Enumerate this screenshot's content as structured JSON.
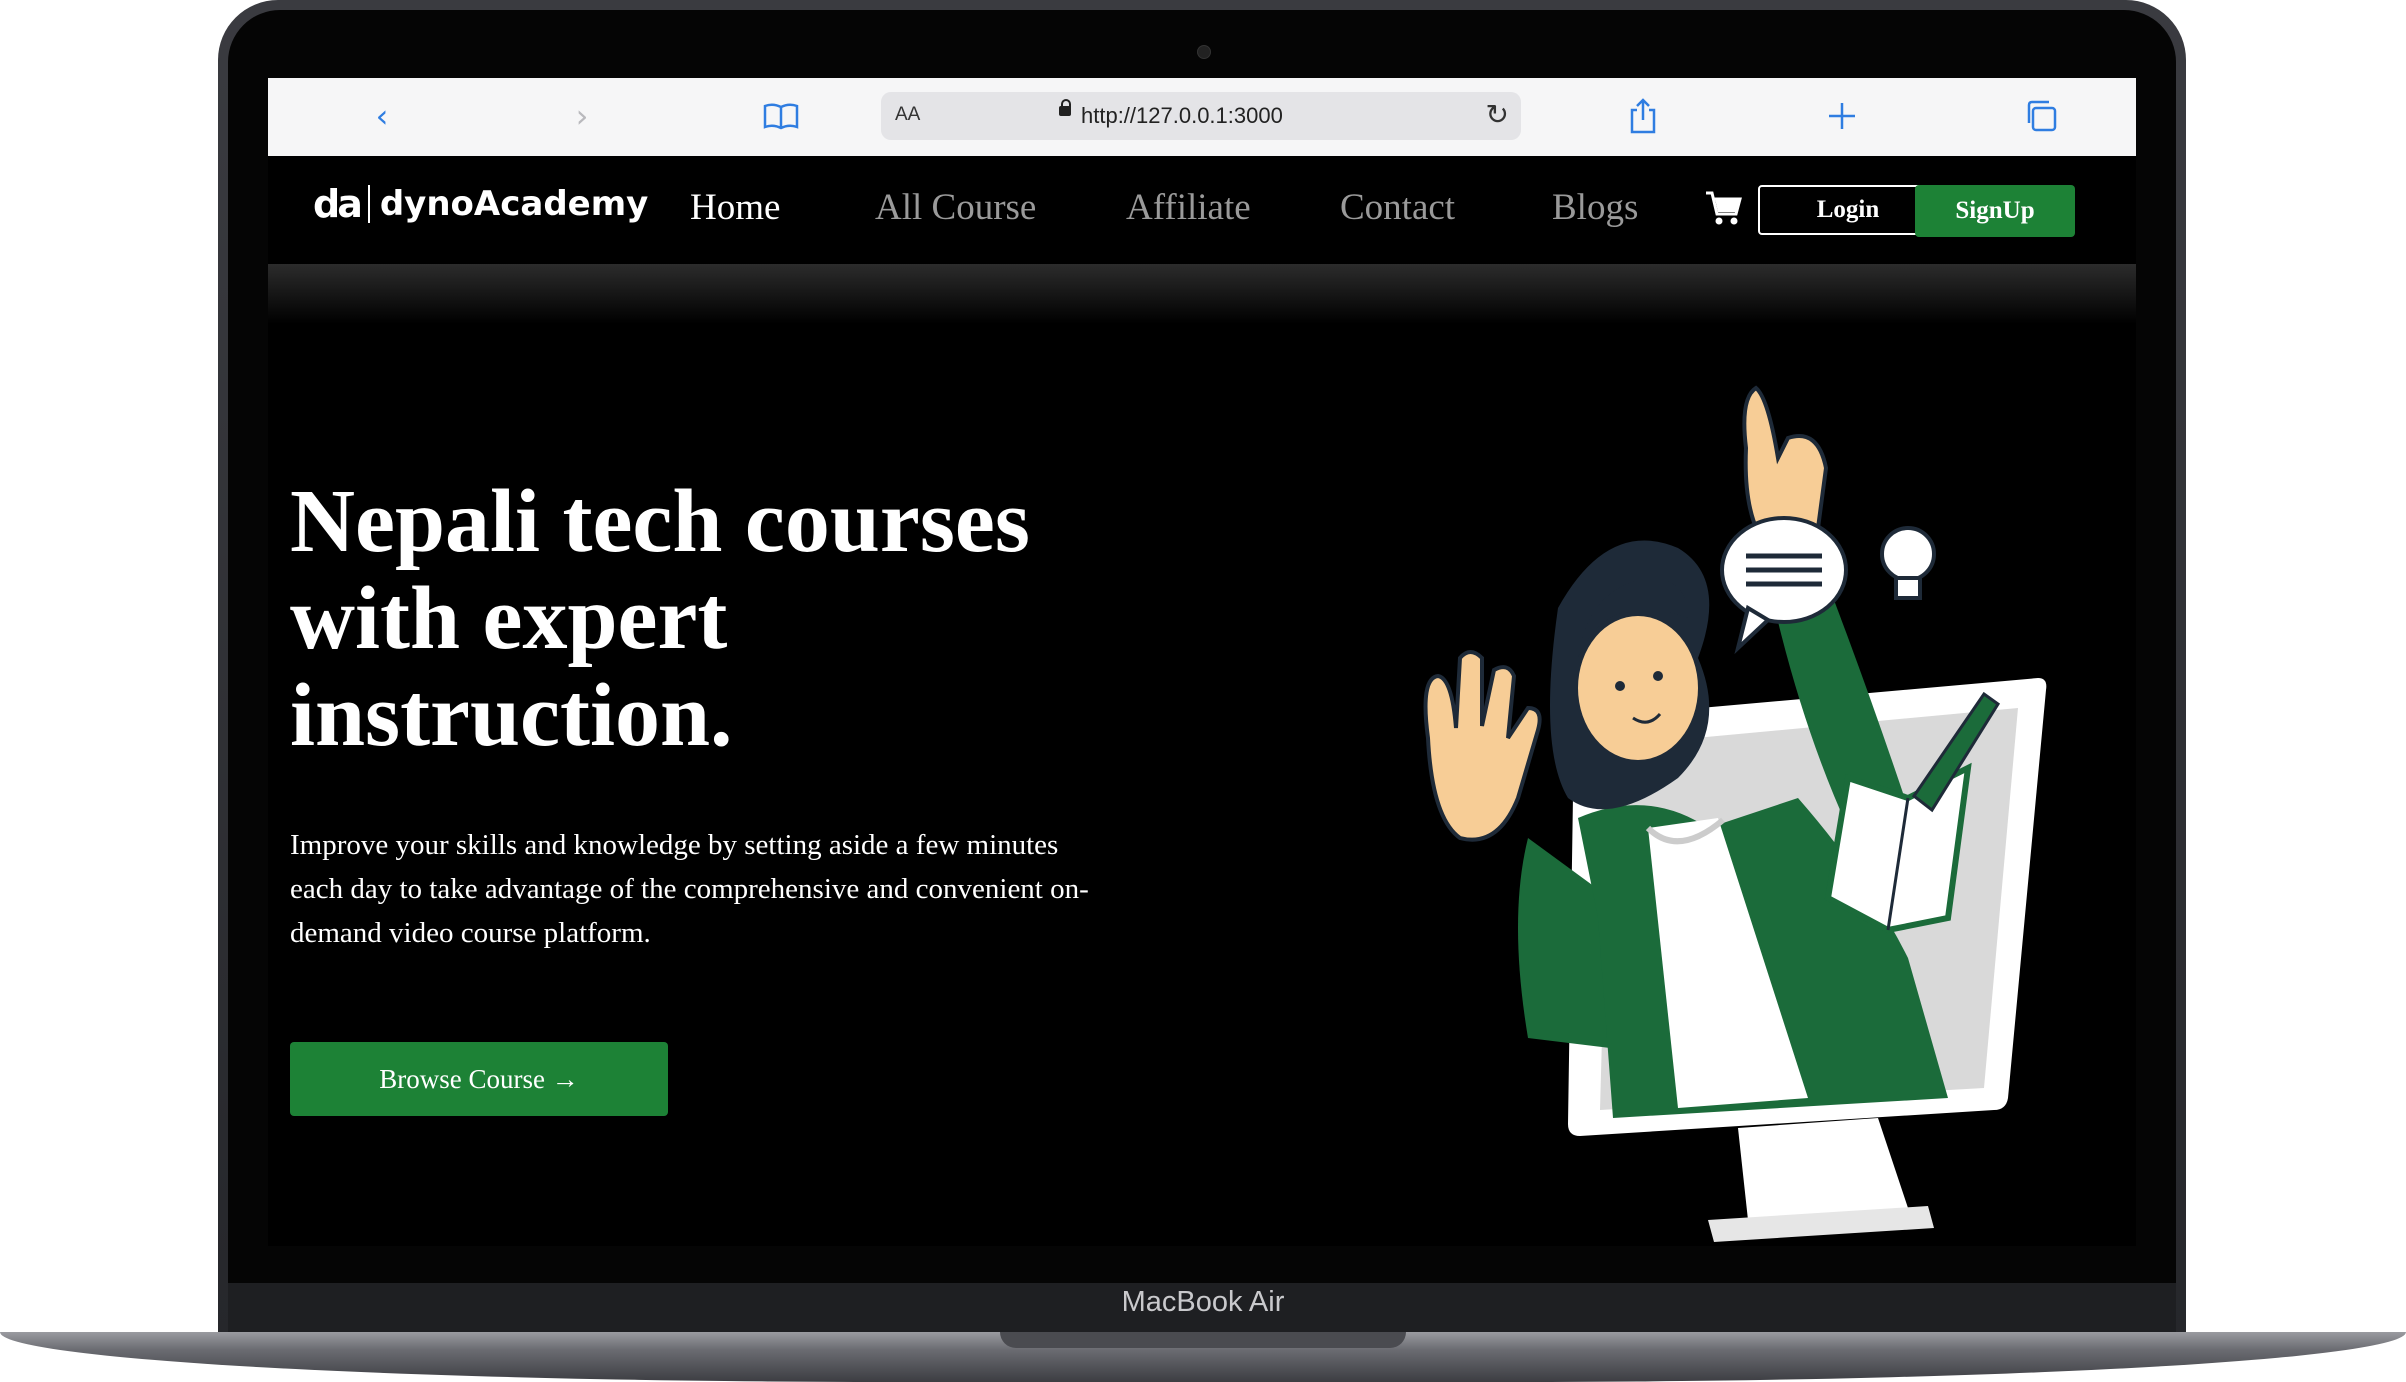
{
  "browser": {
    "text_size_label": "AA",
    "url": "http://127.0.0.1:3000"
  },
  "site": {
    "logo_mark": "da",
    "brand": "dynoAcademy",
    "nav": {
      "home": "Home",
      "all_course": "All Course",
      "affiliate": "Affiliate",
      "contact": "Contact",
      "blogs": "Blogs"
    },
    "login": "Login",
    "signup": "SignUp"
  },
  "hero": {
    "title": "Nepali tech courses with expert instruction.",
    "description": "Improve your skills and knowledge by setting aside a few minutes each day to take advantage of the comprehensive and convenient on-demand video course platform.",
    "cta": "Browse Course →"
  },
  "device_label": "MacBook Air",
  "colors": {
    "accent": "#1d8236",
    "background": "#000000",
    "nav_inactive": "#9a9a9a"
  },
  "icons": [
    "back-icon",
    "forward-icon",
    "bookmarks-icon",
    "lock-icon",
    "reload-icon",
    "share-icon",
    "new-tab-icon",
    "tabs-icon",
    "cart-icon"
  ]
}
